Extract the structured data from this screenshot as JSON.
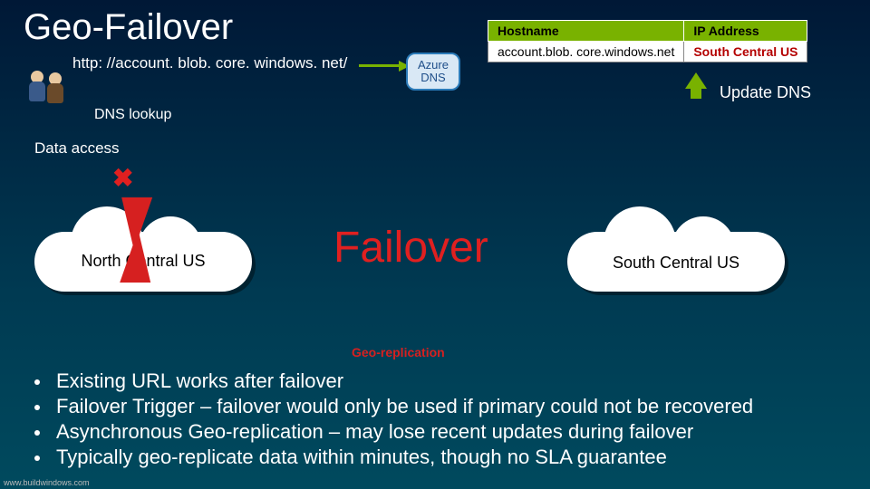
{
  "title": "Geo-Failover",
  "url": "http: //account. blob. core. windows. net/",
  "azure_dns": {
    "line1": "Azure",
    "line2": "DNS"
  },
  "dns_table": {
    "headers": {
      "host": "Hostname",
      "ip": "IP Address"
    },
    "row": {
      "host": "account.blob. core.windows.net",
      "ip": "South Central US"
    }
  },
  "update_dns": "Update DNS",
  "dns_lookup": "DNS lookup",
  "data_access": "Data access",
  "failover": "Failover",
  "cloud_north": "North Central US",
  "cloud_south": "South Central US",
  "geo_replication": "Geo-replication",
  "bullets": [
    "Existing URL works after failover",
    "Failover Trigger – failover would only be used if primary could not be recovered",
    "Asynchronous Geo-replication – may lose recent updates during failover",
    "Typically geo-replicate data within minutes, though no SLA guarantee"
  ],
  "footer": "www.buildwindows.com"
}
